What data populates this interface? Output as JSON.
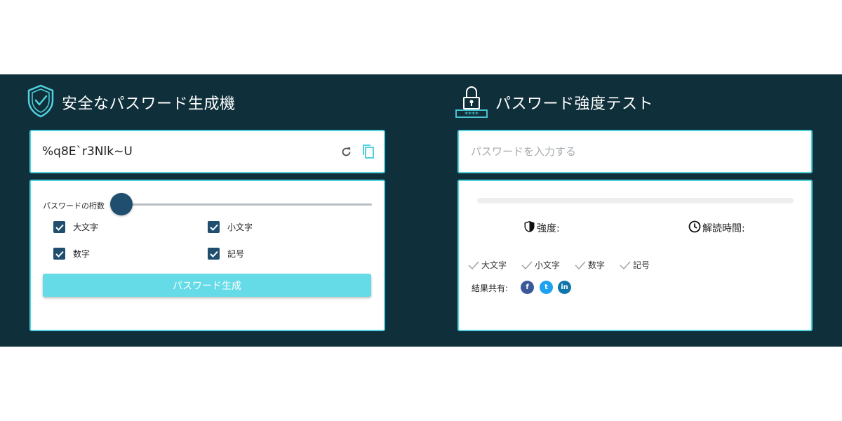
{
  "generator": {
    "title": "安全なパスワード生成機",
    "password": "%q8E`r3Nlk~U",
    "length_label": "パスワードの桁数",
    "length_fraction": 0.0,
    "options": [
      {
        "label": "大文字",
        "checked": true
      },
      {
        "label": "小文字",
        "checked": true
      },
      {
        "label": "数字",
        "checked": true
      },
      {
        "label": "記号",
        "checked": true
      }
    ],
    "generate_label": "パスワード生成"
  },
  "tester": {
    "title": "パスワード強度テスト",
    "input_placeholder": "パスワードを入力する",
    "input_value": "",
    "strength_label": "強度:",
    "crack_time_label": "解読時間:",
    "criteria": [
      "大文字",
      "小文字",
      "数字",
      "記号"
    ],
    "share_label": "結果共有:",
    "share_buttons": [
      {
        "icon": "facebook-icon",
        "glyph": "f",
        "color": "#3b5998"
      },
      {
        "icon": "twitter-icon",
        "glyph": "t",
        "color": "#1da1f2"
      },
      {
        "icon": "linkedin-icon",
        "glyph": "in",
        "color": "#0e76a8"
      }
    ]
  },
  "colors": {
    "band": "#0f2f3a",
    "accent": "#4fd1de",
    "checkbox": "#1f4e6e",
    "button": "#64dbe6"
  }
}
